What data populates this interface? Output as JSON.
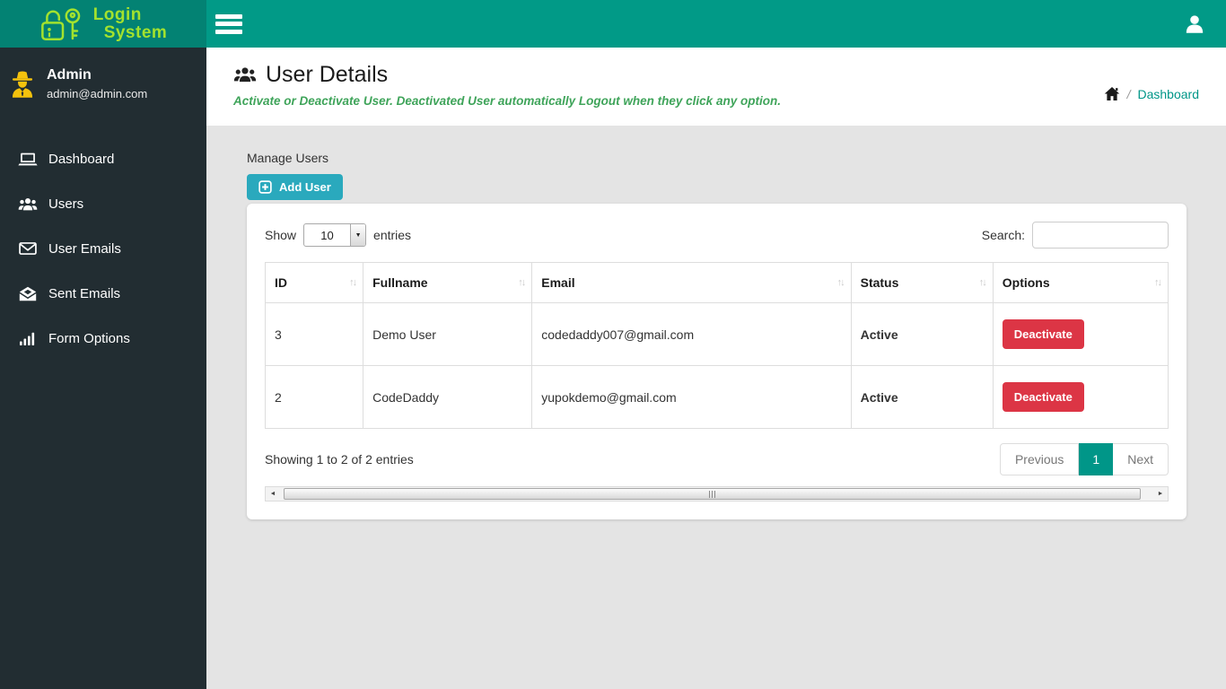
{
  "brand": {
    "line1": "Login",
    "line2": "System"
  },
  "sidebar": {
    "user": {
      "name": "Admin",
      "email": "admin@admin.com"
    },
    "items": [
      {
        "label": "Dashboard",
        "icon": "laptop-icon"
      },
      {
        "label": "Users",
        "icon": "users-icon"
      },
      {
        "label": "User Emails",
        "icon": "envelope-icon"
      },
      {
        "label": "Sent Emails",
        "icon": "envelope-open-icon"
      },
      {
        "label": "Form Options",
        "icon": "signal-bars-icon"
      }
    ]
  },
  "page": {
    "title": "User Details",
    "subtitle": "Activate or Deactivate User. Deactivated User automatically Logout when they click any option.",
    "breadcrumb_link": "Dashboard",
    "breadcrumb_separator": "/"
  },
  "panel": {
    "heading": "Manage Users",
    "add_user_label": "Add User"
  },
  "table": {
    "show_label": "Show",
    "page_length": "10",
    "entries_label": "entries",
    "search_label": "Search:",
    "columns": [
      "ID",
      "Fullname",
      "Email",
      "Status",
      "Options"
    ],
    "sort_glyph": "↑↓",
    "rows": [
      {
        "id": "3",
        "fullname": "Demo User",
        "email": "codedaddy007@gmail.com",
        "status": "Active",
        "action": "Deactivate"
      },
      {
        "id": "2",
        "fullname": "CodeDaddy",
        "email": "yupokdemo@gmail.com",
        "status": "Active",
        "action": "Deactivate"
      }
    ],
    "info": "Showing 1 to 2 of 2 entries",
    "pagination": {
      "previous": "Previous",
      "current": "1",
      "next": "Next"
    }
  },
  "scrollbar": {
    "left_arrow": "◄",
    "right_arrow": "►"
  },
  "colors": {
    "header_bg": "#019a87",
    "logo_bg": "#038273",
    "sidebar_bg": "#222d32",
    "brand_text": "#a3e22e",
    "admin_icon": "#f4c20d",
    "subtitle_green": "#3fa45a",
    "link_teal": "#009688",
    "add_user_btn": "#2aa9bd",
    "danger_btn": "#dc3545",
    "pagination_active": "#009688",
    "page_bg": "#e4e4e4"
  }
}
